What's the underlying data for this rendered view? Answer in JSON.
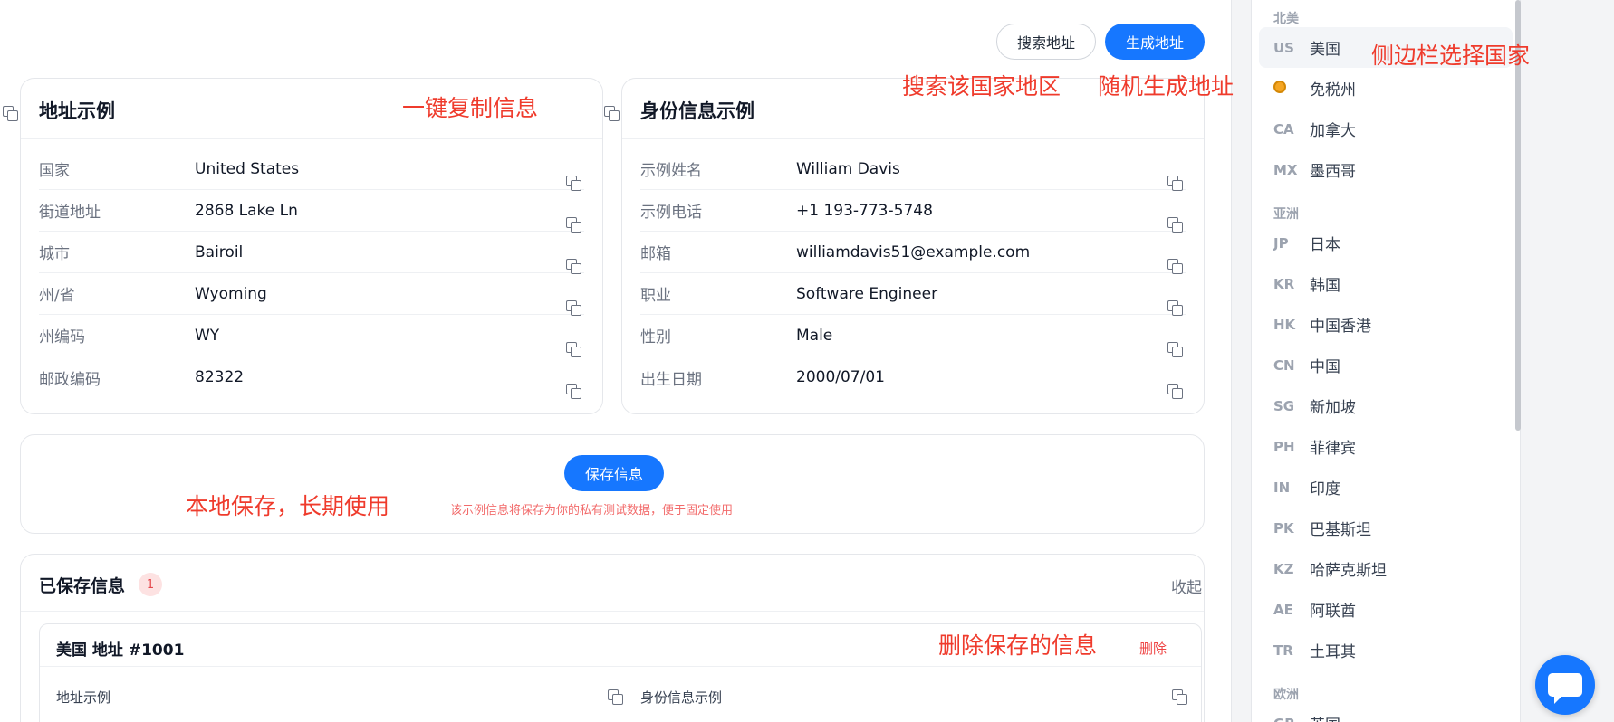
{
  "toolbar": {
    "search_label": "搜索地址",
    "generate_label": "生成地址"
  },
  "address_card": {
    "title": "地址示例",
    "rows": [
      {
        "label": "国家",
        "value": "United States"
      },
      {
        "label": "街道地址",
        "value": "2868 Lake Ln"
      },
      {
        "label": "城市",
        "value": "Bairoil"
      },
      {
        "label": "州/省",
        "value": "Wyoming"
      },
      {
        "label": "州编码",
        "value": "WY"
      },
      {
        "label": "邮政编码",
        "value": "82322"
      }
    ]
  },
  "identity_card": {
    "title": "身份信息示例",
    "rows": [
      {
        "label": "示例姓名",
        "value": "William Davis"
      },
      {
        "label": "示例电话",
        "value": "+1 193-773-5748"
      },
      {
        "label": "邮箱",
        "value": "williamdavis51@example.com"
      },
      {
        "label": "职业",
        "value": "Software Engineer"
      },
      {
        "label": "性别",
        "value": "Male"
      },
      {
        "label": "出生日期",
        "value": "2000/07/01"
      }
    ]
  },
  "save": {
    "button_label": "保存信息",
    "hint": "该示例信息将保存为你的私有测试数据，便于固定使用"
  },
  "saved": {
    "title": "已保存信息",
    "count": "1",
    "collapse_label": "收起",
    "record": {
      "title": "美国 地址 #1001",
      "delete_label": "删除",
      "address_label": "地址示例",
      "identity_label": "身份信息示例"
    }
  },
  "annotations": {
    "copy": "一键复制信息",
    "search": "搜索该国家地区",
    "generate": "随机生成地址",
    "sidebar": "侧边栏选择国家",
    "save": "本地保存，长期使用",
    "delete": "删除保存的信息"
  },
  "sidebar": {
    "groups": [
      {
        "name": "北美",
        "items": [
          {
            "code": "US",
            "name": "美国",
            "active": true
          },
          {
            "code": "",
            "name": "免税州",
            "icon": "medal-icon"
          },
          {
            "code": "CA",
            "name": "加拿大"
          },
          {
            "code": "MX",
            "name": "墨西哥"
          }
        ]
      },
      {
        "name": "亚洲",
        "items": [
          {
            "code": "JP",
            "name": "日本"
          },
          {
            "code": "KR",
            "name": "韩国"
          },
          {
            "code": "HK",
            "name": "中国香港"
          },
          {
            "code": "CN",
            "name": "中国"
          },
          {
            "code": "SG",
            "name": "新加坡"
          },
          {
            "code": "PH",
            "name": "菲律宾"
          },
          {
            "code": "IN",
            "name": "印度"
          },
          {
            "code": "PK",
            "name": "巴基斯坦"
          },
          {
            "code": "KZ",
            "name": "哈萨克斯坦"
          },
          {
            "code": "AE",
            "name": "阿联酋"
          },
          {
            "code": "TR",
            "name": "土耳其"
          }
        ]
      },
      {
        "name": "欧洲",
        "items": [
          {
            "code": "GB",
            "name": "英国"
          }
        ]
      }
    ]
  },
  "colors": {
    "primary": "#1677ff",
    "annotation": "#ef3b2c",
    "danger": "#ef4444"
  }
}
